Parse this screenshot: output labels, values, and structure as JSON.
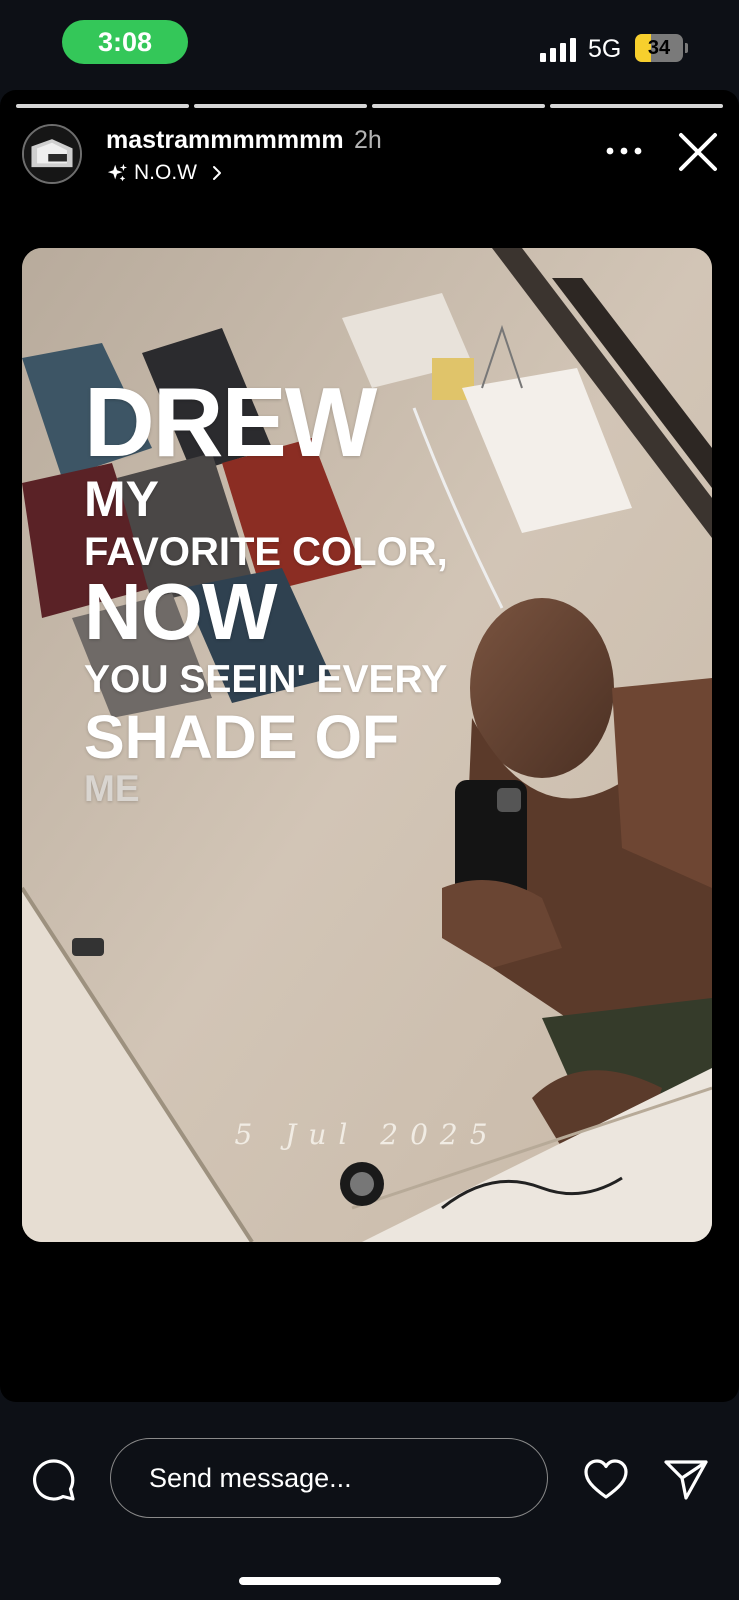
{
  "status_bar": {
    "time": "3:08",
    "network": "5G",
    "battery_level": "34",
    "battery_percent": 34,
    "time_pill_color": "#34c759",
    "battery_fill_color": "#f7cf2d"
  },
  "story": {
    "segments_total": 4,
    "segments_viewed": 4,
    "username": "mastrammmmmmm",
    "time_ago": "2h",
    "subtitle": "N.O.W",
    "subtitle_icon": "sparkle-icon",
    "more_icon": "more-dots-icon",
    "close_icon": "close-icon"
  },
  "photo_overlay": {
    "line1": "DREW",
    "line2": "MY",
    "line3": "FAVORITE COLOR,",
    "line4": "NOW",
    "line5": "YOU SEEIN' EVERY",
    "line6": "SHADE OF",
    "line7": "ME",
    "date": "5 Jul 2025"
  },
  "bottom_bar": {
    "comment_icon": "comment-bubble-icon",
    "message_placeholder": "Send message...",
    "heart_icon": "heart-icon",
    "send_icon": "send-paper-plane-icon"
  }
}
